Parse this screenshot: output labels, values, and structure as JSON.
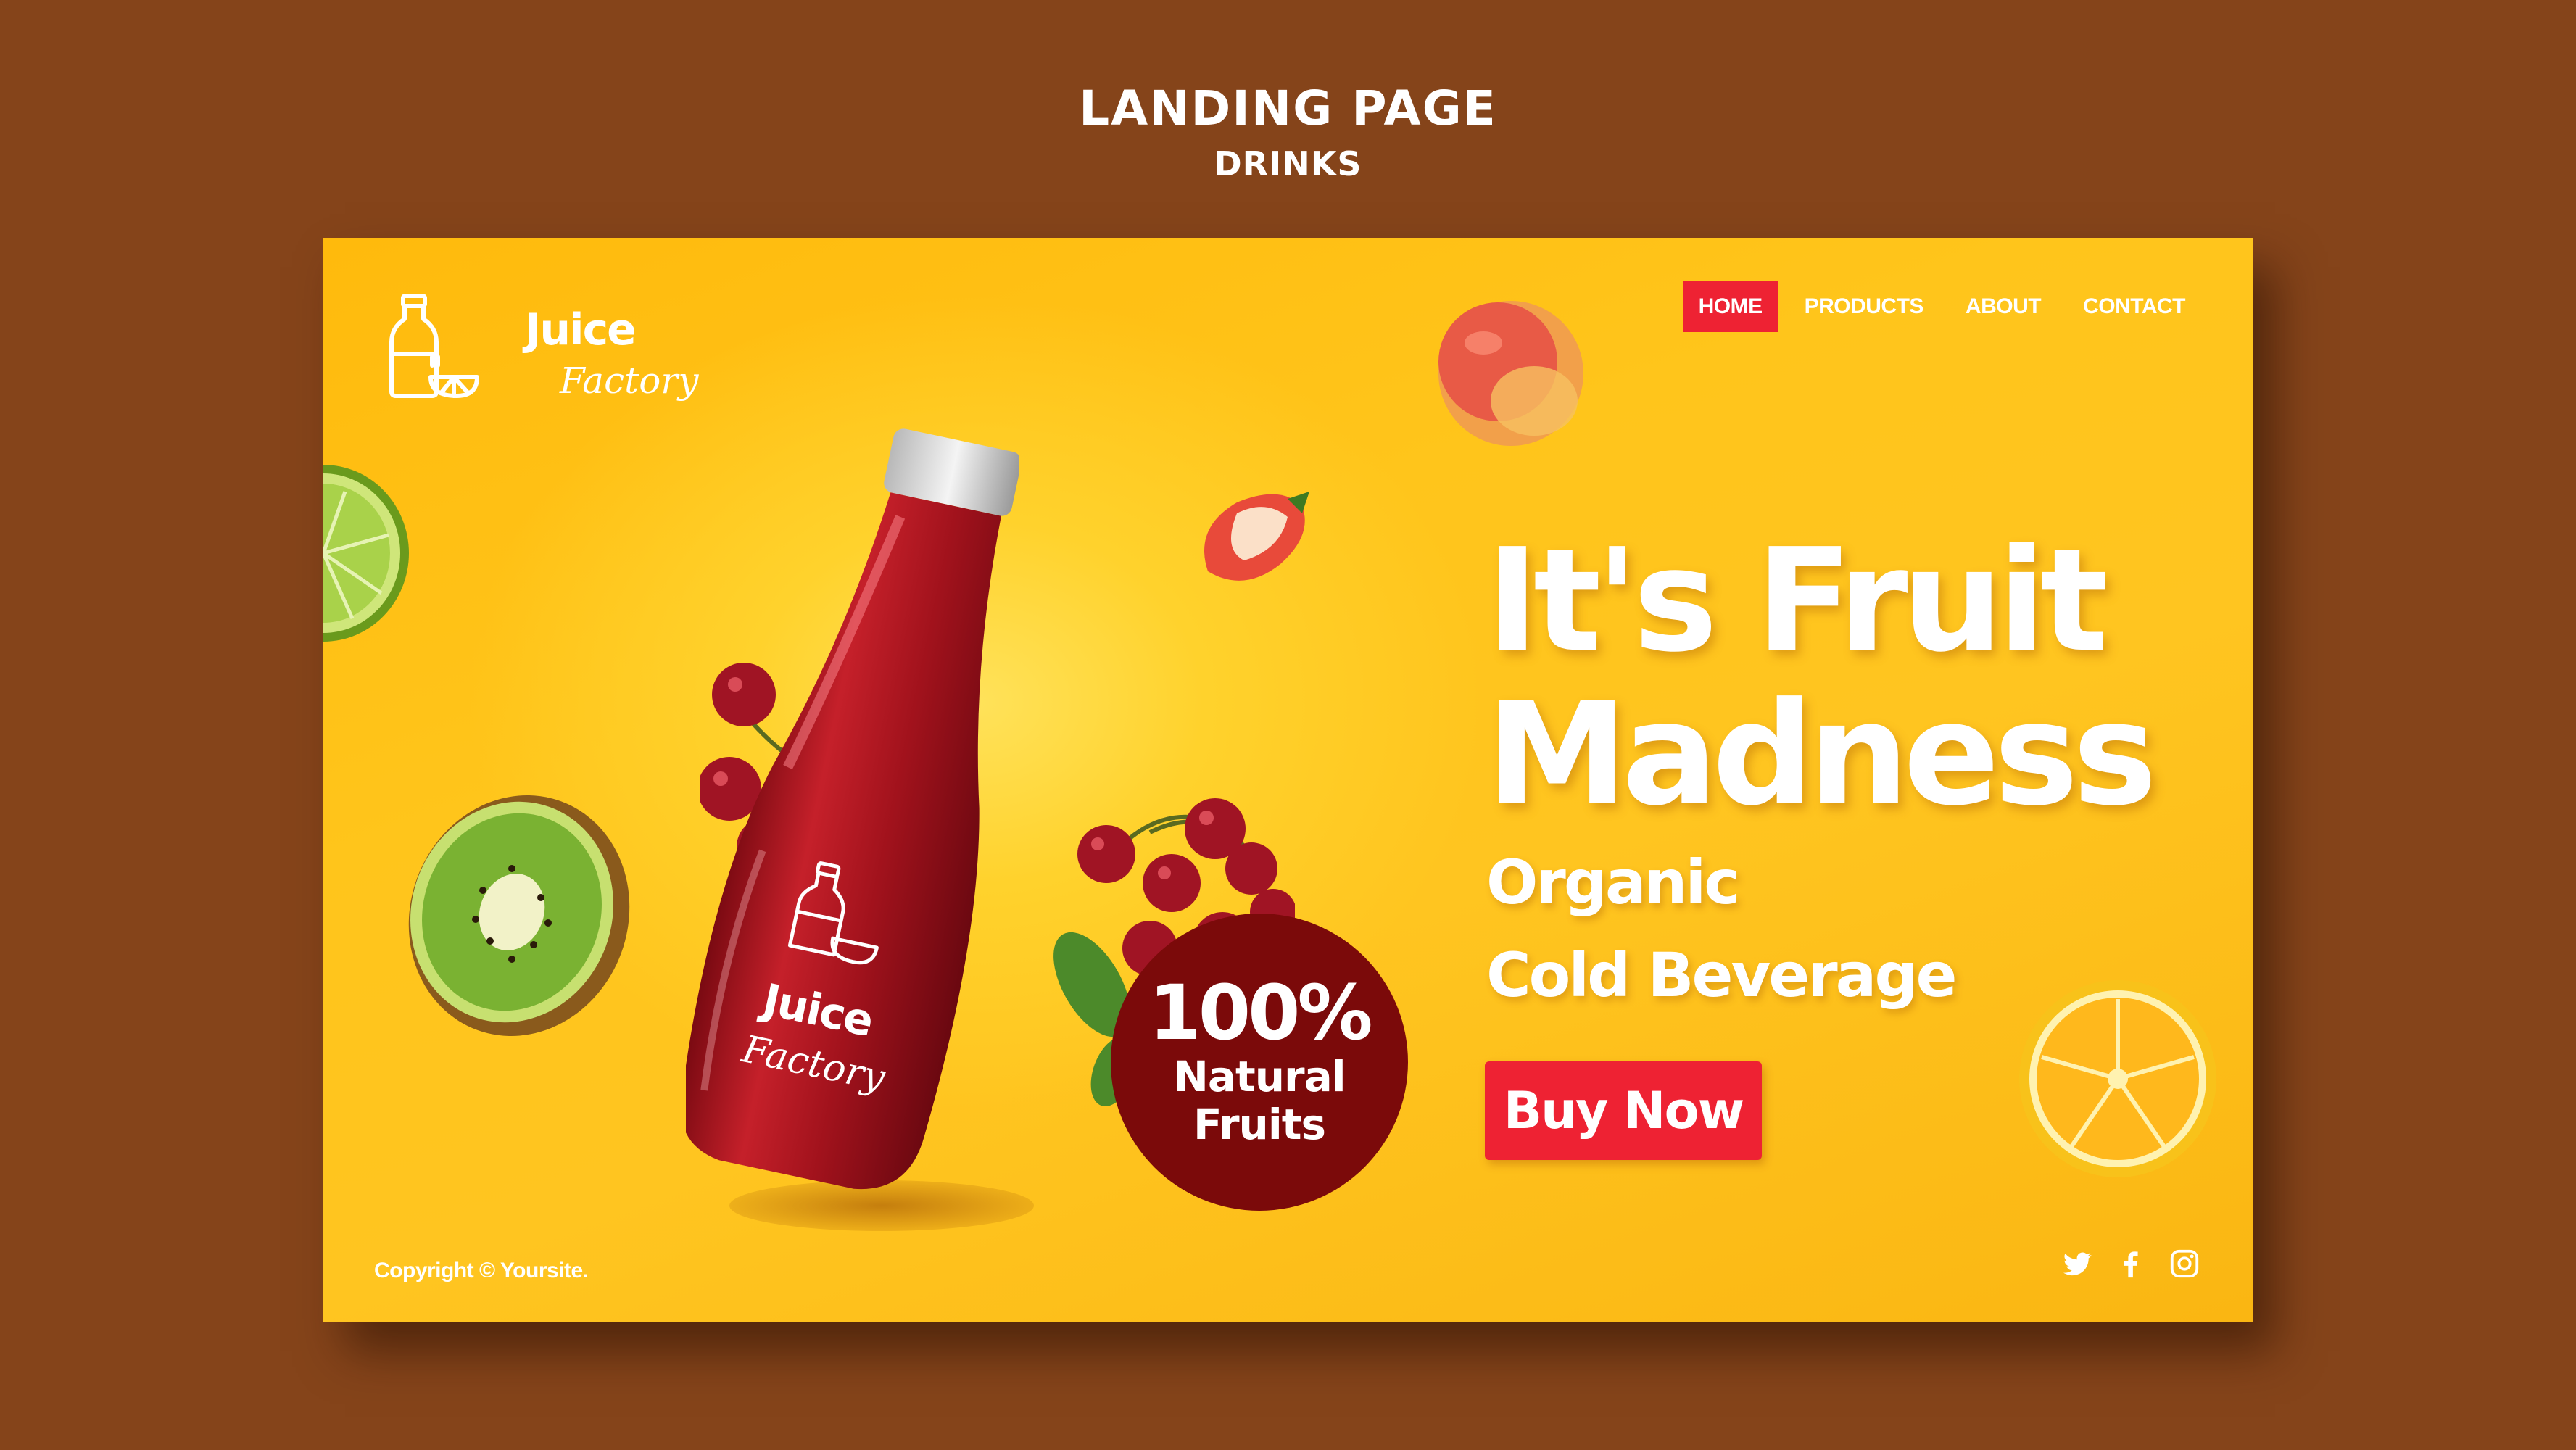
{
  "presentation": {
    "title": "LANDING PAGE",
    "subtitle": "DRINKS"
  },
  "logo": {
    "line1": "Juice",
    "line2": "Factory"
  },
  "nav": {
    "items": [
      "HOME",
      "PRODUCTS",
      "ABOUT",
      "CONTACT"
    ],
    "active": "HOME"
  },
  "hero": {
    "title_line1": "It's Fruit",
    "title_line2": "Madness",
    "sub_line1": "Organic",
    "sub_line2": "Cold Beverage",
    "cta": "Buy Now"
  },
  "badge": {
    "percent": "100%",
    "line1": "Natural",
    "line2": "Fruits"
  },
  "bottle_label": {
    "line1": "Juice",
    "line2": "Factory"
  },
  "footer": {
    "copyright": "Copyright © Yoursite."
  },
  "social": [
    "twitter-icon",
    "facebook-icon",
    "instagram-icon"
  ],
  "colors": {
    "background": "#85441a",
    "page_yellow": "#ffc51b",
    "accent_red": "#ee2233",
    "badge_maroon": "#7b0a0a",
    "text_white": "#ffffff"
  }
}
